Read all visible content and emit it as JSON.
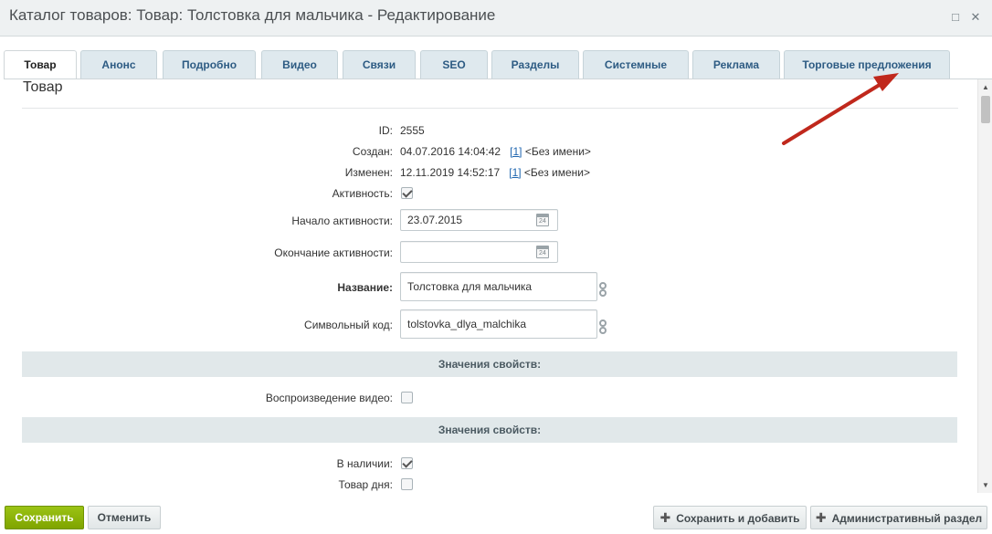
{
  "window": {
    "title": "Каталог товаров: Товар: Толстовка для мальчика - Редактирование",
    "maximize_icon": "□",
    "close_icon": "✕"
  },
  "tabs": [
    {
      "label": "Товар",
      "active": true
    },
    {
      "label": "Анонс"
    },
    {
      "label": "Подробно"
    },
    {
      "label": "Видео"
    },
    {
      "label": "Связи"
    },
    {
      "label": "SEO"
    },
    {
      "label": "Разделы"
    },
    {
      "label": "Системные"
    },
    {
      "label": "Реклама"
    },
    {
      "label": "Торговые предложения"
    }
  ],
  "section": {
    "title": "Товар"
  },
  "fields": {
    "id": {
      "label": "ID:",
      "value": "2555"
    },
    "created": {
      "label": "Создан:",
      "date": "04.07.2016 14:04:42",
      "user_link": "[1]",
      "user_name": "<Без имени>"
    },
    "modified": {
      "label": "Изменен:",
      "date": "12.11.2019 14:52:17",
      "user_link": "[1]",
      "user_name": "<Без имени>"
    },
    "active": {
      "label": "Активность:",
      "checked": true
    },
    "active_from": {
      "label": "Начало активности:",
      "value": "23.07.2015"
    },
    "active_to": {
      "label": "Окончание активности:",
      "value": ""
    },
    "name": {
      "label": "Название:",
      "value": "Толстовка для мальчика"
    },
    "code": {
      "label": "Символьный код:",
      "value": "tolstovka_dlya_malchika"
    },
    "props_header_1": "Значения свойств:",
    "video": {
      "label": "Воспроизведение видео:",
      "checked": false
    },
    "props_header_2": "Значения свойств:",
    "in_stock": {
      "label": "В наличии:",
      "checked": true
    },
    "deal_of_day": {
      "label": "Товар дня:",
      "checked": false
    }
  },
  "calendar_icon_text": "24",
  "footer": {
    "save": "Сохранить",
    "cancel": "Отменить",
    "save_add": "Сохранить и добавить",
    "admin_section": "Административный раздел"
  },
  "colors": {
    "save_button": "#86ad00",
    "annotation_arrow": "#c0281c",
    "tab_text": "#2d5b83"
  }
}
